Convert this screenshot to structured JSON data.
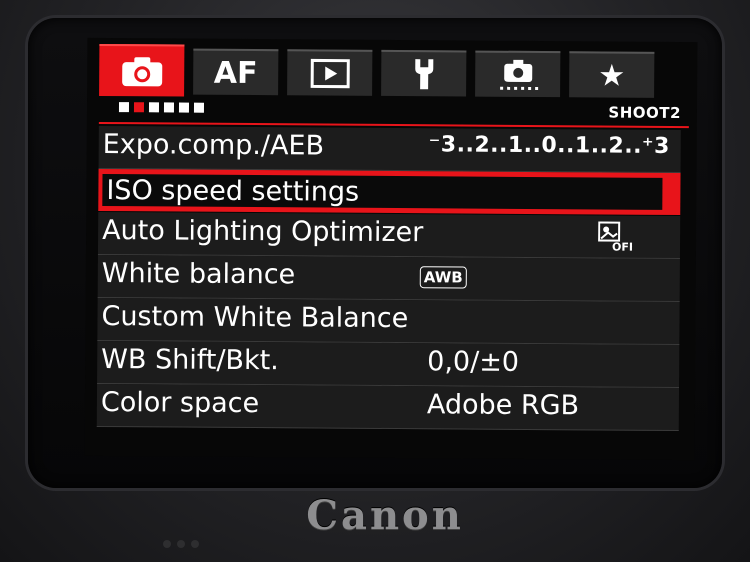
{
  "tabs": [
    {
      "name": "shooting",
      "label": "",
      "icon": "camera-icon",
      "active": true
    },
    {
      "name": "af",
      "label": "AF",
      "icon": "",
      "active": false
    },
    {
      "name": "playback",
      "label": "",
      "icon": "play-icon",
      "active": false
    },
    {
      "name": "setup",
      "label": "",
      "icon": "wrench-icon",
      "active": false
    },
    {
      "name": "custom-functions",
      "label": "",
      "icon": "custom-camera-icon",
      "active": false
    },
    {
      "name": "my-menu",
      "label": "★",
      "icon": "star-icon",
      "active": false
    }
  ],
  "page_indicator": {
    "count": 6,
    "active_index": 1
  },
  "page_name": "SHOOT2",
  "menu": [
    {
      "label": "Expo.comp./AEB",
      "value": "⁻3..2..1..0..1..2..⁺3",
      "type": "scale"
    },
    {
      "label": "ISO speed settings",
      "value": "",
      "selected": true
    },
    {
      "label": "Auto Lighting Optimizer",
      "value": "",
      "icon": "alo-off-icon"
    },
    {
      "label": "White balance",
      "value": "AWB",
      "type": "badge"
    },
    {
      "label": "Custom White Balance",
      "value": ""
    },
    {
      "label": "WB Shift/Bkt.",
      "value": "0,0/±0"
    },
    {
      "label": "Color space",
      "value": "Adobe RGB"
    }
  ],
  "brand": "Canon",
  "colors": {
    "accent": "#e8141a",
    "background": "#070707",
    "row": "#1c1c1c",
    "text": "#ffffff"
  }
}
